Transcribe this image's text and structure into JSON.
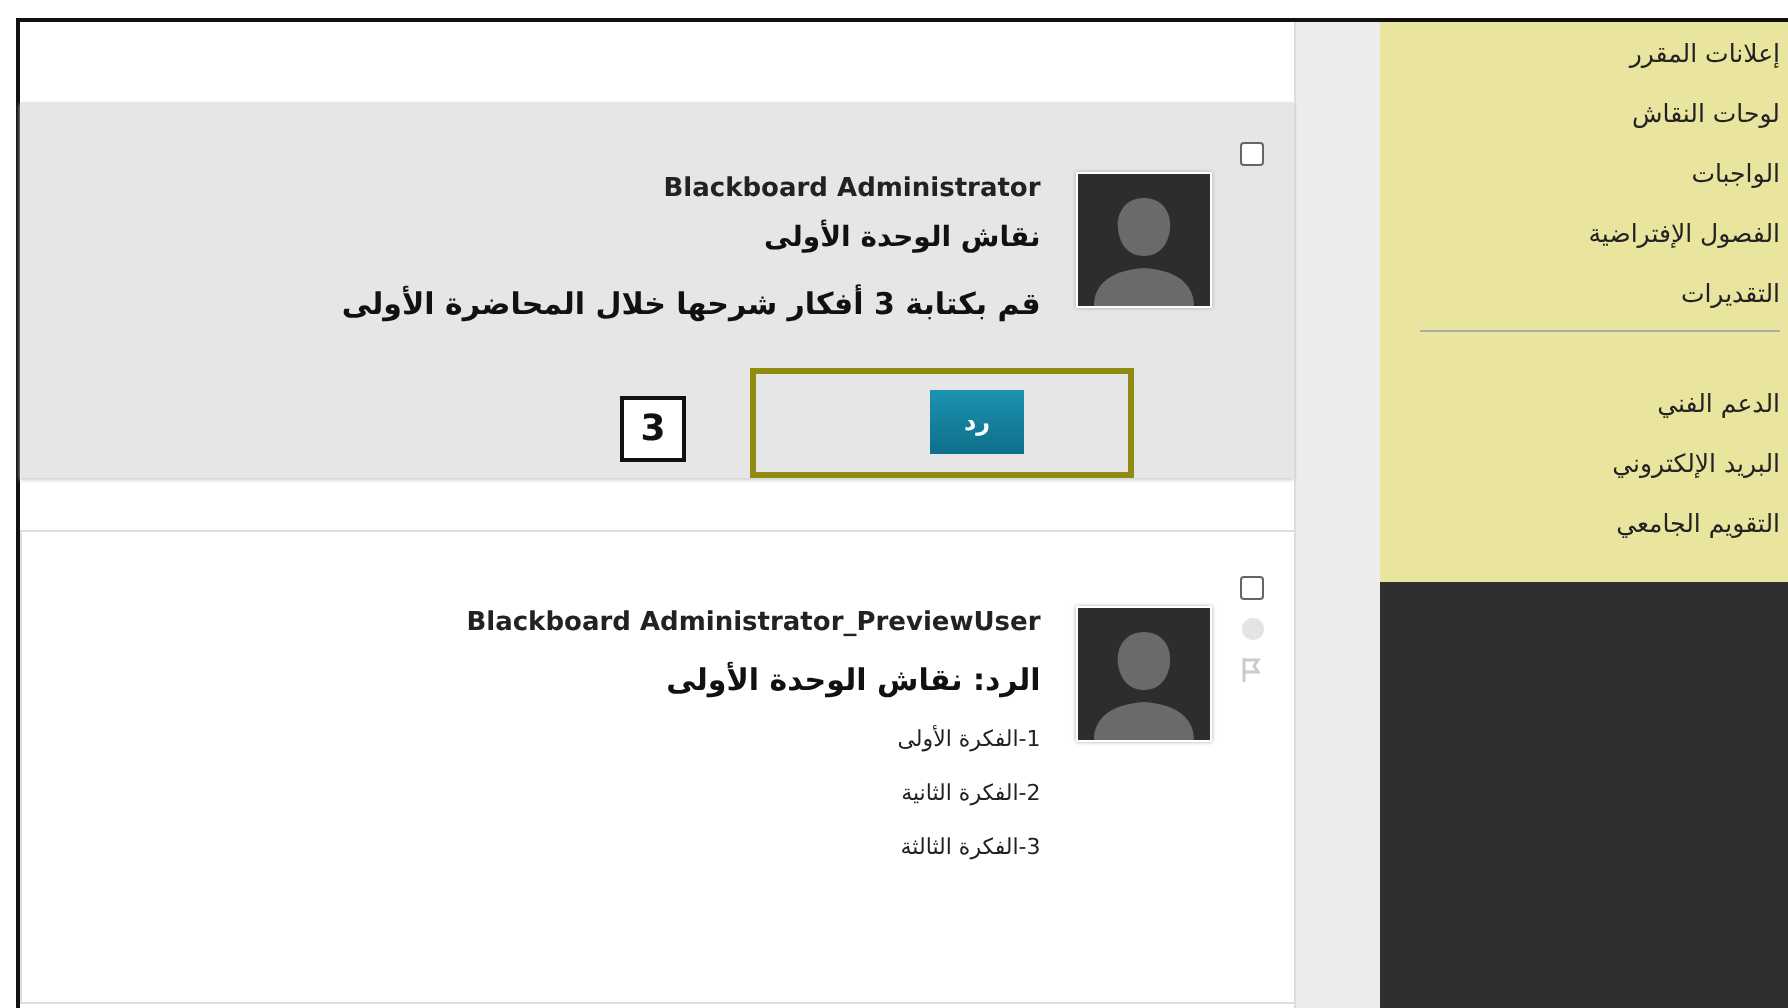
{
  "posts": [
    {
      "kind": "original",
      "author": "Blackboard Administrator",
      "title": "نقاش الوحدة الأولى",
      "body": [
        "قم بكتابة 3 أفكار شرحها خلال المحاضرة الأولى"
      ],
      "checked": false,
      "reply_button": "رد",
      "annotation": "3"
    },
    {
      "kind": "reply",
      "author": "Blackboard Administrator_PreviewUser",
      "title": "الرد: نقاش الوحدة الأولى",
      "body": [
        "1-الفكرة الأولى",
        "2-الفكرة الثانية",
        "3-الفكرة الثالثة"
      ],
      "checked": false
    }
  ],
  "sidebar": {
    "groups": [
      [
        "إعلانات المقرر",
        "لوحات النقاش",
        "الواجبات",
        "الفصول الإفتراضية",
        "التقديرات"
      ],
      [
        "الدعم الفني",
        "البريد الإلكتروني",
        "التقويم الجامعي"
      ]
    ]
  }
}
